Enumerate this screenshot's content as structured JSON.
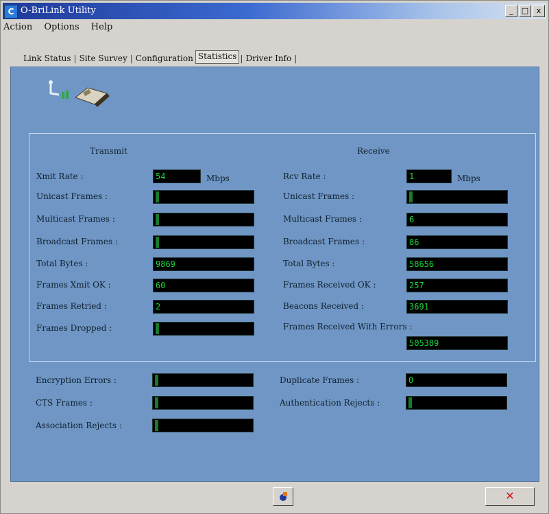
{
  "window": {
    "title": "O-BriLink Utility",
    "app_icon_letter": "C",
    "controls": {
      "minimize": "_",
      "maximize": "□",
      "close": "x"
    }
  },
  "menu": [
    "Action",
    "Options",
    "Help"
  ],
  "tabs": [
    "Link Status",
    "Site Survey",
    "Configuration",
    "Statistics",
    "Driver Info"
  ],
  "active_tab": "Statistics",
  "transmit": {
    "header": "Transmit",
    "rows": [
      {
        "label": "Xmit Rate :",
        "value": "54",
        "unit": "Mbps"
      },
      {
        "label": "Unicast Frames :",
        "value": ""
      },
      {
        "label": "Multicast Frames :",
        "value": ""
      },
      {
        "label": "Broadcast Frames :",
        "value": ""
      },
      {
        "label": "Total Bytes :",
        "value": "9869"
      },
      {
        "label": "Frames Xmit OK :",
        "value": "60"
      },
      {
        "label": "Frames Retried :",
        "value": "2"
      },
      {
        "label": "Frames Dropped :",
        "value": ""
      }
    ]
  },
  "receive": {
    "header": "Receive",
    "rows": [
      {
        "label": "Rcv Rate :",
        "value": "1",
        "unit": "Mbps"
      },
      {
        "label": "Unicast Frames :",
        "value": ""
      },
      {
        "label": "Multicast Frames :",
        "value": "6"
      },
      {
        "label": "Broadcast Frames :",
        "value": "86"
      },
      {
        "label": "Total Bytes :",
        "value": "58656"
      },
      {
        "label": "Frames Received OK :",
        "value": "257"
      },
      {
        "label": "Beacons Received :",
        "value": "3691"
      },
      {
        "label": "Frames Received With Errors :",
        "value": "505389"
      }
    ]
  },
  "errors": {
    "left": [
      {
        "label": "Encryption Errors :",
        "value": ""
      },
      {
        "label": "CTS Frames :",
        "value": ""
      },
      {
        "label": "Association Rejects :",
        "value": ""
      }
    ],
    "right": [
      {
        "label": "Duplicate Frames :",
        "value": "0"
      },
      {
        "label": "Authentication Rejects :",
        "value": ""
      }
    ]
  },
  "bottom": {
    "close_glyph": "✕"
  },
  "colors": {
    "panel": "#6f96c4",
    "field_bg": "#000000",
    "field_text": "#1bd83c",
    "close_x": "#d21010"
  }
}
